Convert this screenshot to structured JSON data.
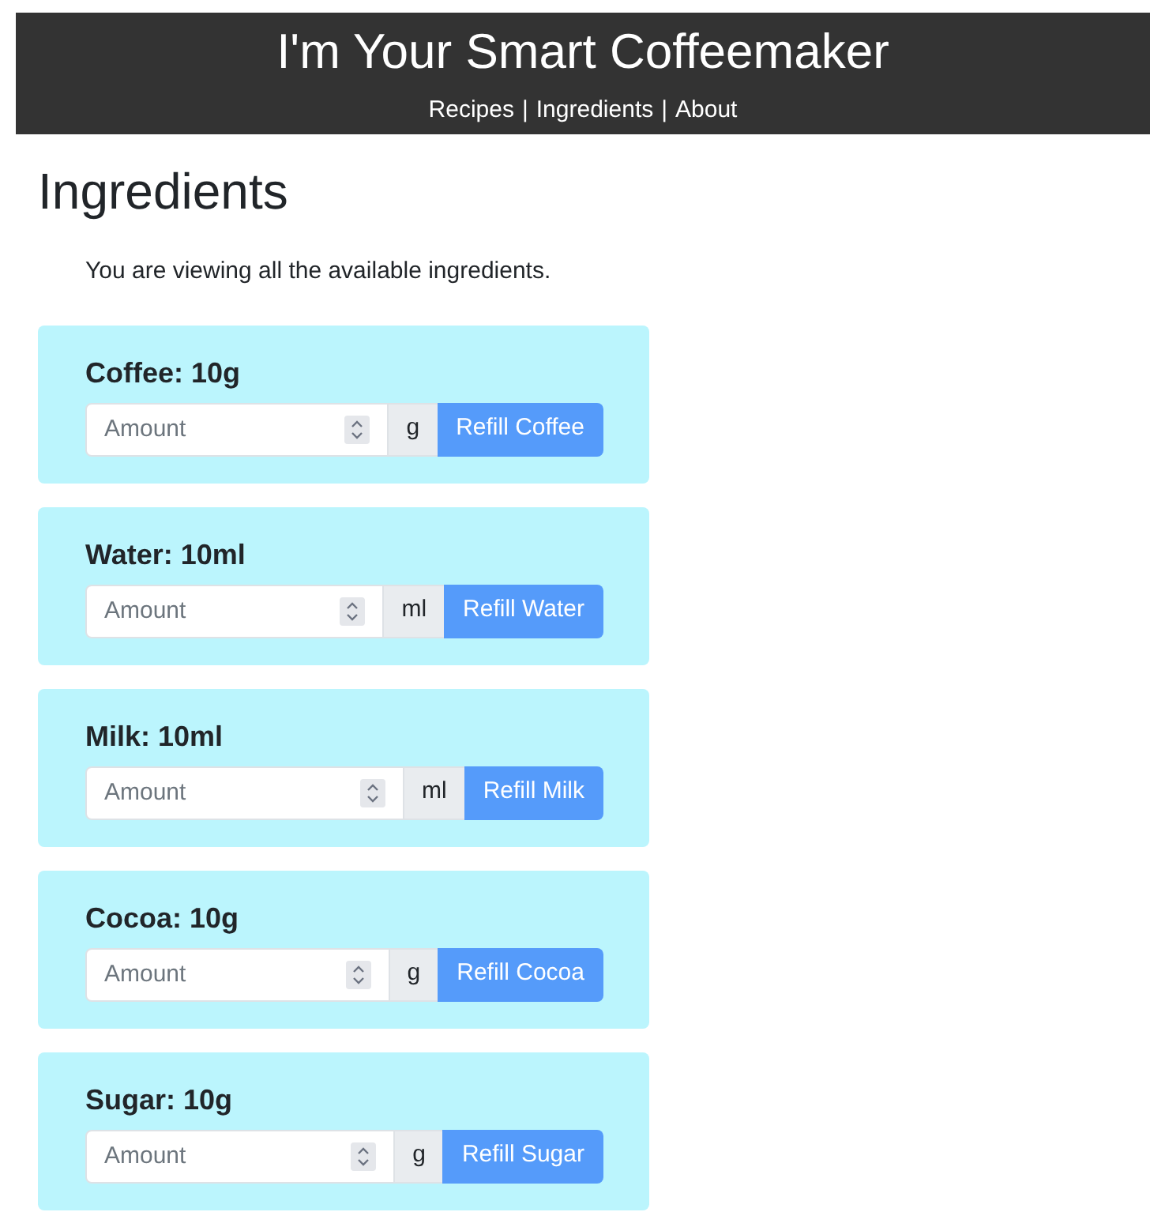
{
  "header": {
    "title": "I'm Your Smart Coffeemaker",
    "nav": [
      {
        "label": "Recipes"
      },
      {
        "label": "Ingredients"
      },
      {
        "label": "About"
      }
    ],
    "separators": [
      "|",
      "|"
    ]
  },
  "page": {
    "heading": "Ingredients",
    "intro": "You are viewing all the available ingredients."
  },
  "ingredients": [
    {
      "title": "Coffee: 10g",
      "placeholder": "Amount",
      "unit": "g",
      "button": "Refill Coffee"
    },
    {
      "title": "Water: 10ml",
      "placeholder": "Amount",
      "unit": "ml",
      "button": "Refill Water"
    },
    {
      "title": "Milk: 10ml",
      "placeholder": "Amount",
      "unit": "ml",
      "button": "Refill Milk"
    },
    {
      "title": "Cocoa: 10g",
      "placeholder": "Amount",
      "unit": "g",
      "button": "Refill Cocoa"
    },
    {
      "title": "Sugar: 10g",
      "placeholder": "Amount",
      "unit": "g",
      "button": "Refill Sugar"
    }
  ]
}
